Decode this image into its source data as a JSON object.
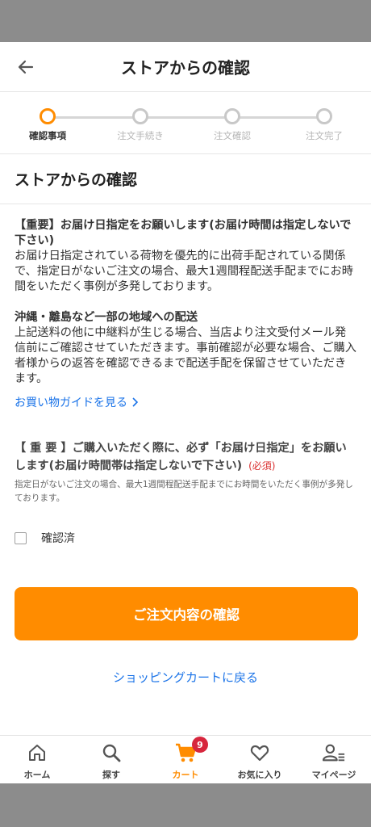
{
  "header": {
    "title": "ストアからの確認"
  },
  "stepper": {
    "steps": [
      {
        "label": "確認事項",
        "active": true
      },
      {
        "label": "注文手続き",
        "active": false
      },
      {
        "label": "注文確認",
        "active": false
      },
      {
        "label": "注文完了",
        "active": false
      }
    ]
  },
  "section_title": "ストアからの確認",
  "notices": [
    {
      "heading": "【重要】お届け日指定をお願いします(お届け時間は指定しないで下さい)",
      "body": "お届け日指定されている荷物を優先的に出荷手配されている関係で、指定日がないご注文の場合、最大1週間程配送手配までにお時間をいただく事例が多発しております。"
    },
    {
      "heading": "沖縄・離島など一部の地域への配送",
      "body": "上記送料の他に中継料が生じる場合、当店より注文受付メール発信前にご確認させていただきます。事前確認が必要な場合、ご購入者様からの返答を確認できるまで配送手配を保留させていただきます。"
    }
  ],
  "guide_link": "お買い物ガイドを見る",
  "required": {
    "title": "【 重 要 】ご購入いただく際に、必ず「お届け日指定」をお願いします(お届け時間帯は指定しないで下さい)",
    "tag": "(必須)",
    "description": "指定日がないご注文の場合、最大1週間程配送手配までにお時間をいただく事例が多発しております。"
  },
  "checkbox": {
    "label": "確認済",
    "checked": false
  },
  "confirm_button": "ご注文内容の確認",
  "back_to_cart": "ショッピングカートに戻る",
  "tabbar": {
    "items": [
      {
        "label": "ホーム",
        "icon": "home-icon"
      },
      {
        "label": "探す",
        "icon": "search-icon"
      },
      {
        "label": "カート",
        "icon": "cart-icon",
        "active": true,
        "badge": "9"
      },
      {
        "label": "お気に入り",
        "icon": "heart-icon"
      },
      {
        "label": "マイページ",
        "icon": "user-list-icon"
      }
    ]
  },
  "colors": {
    "accent": "#ff8c00",
    "link": "#1a73e8",
    "badge": "#d7263d",
    "required": "#d92c2c"
  }
}
